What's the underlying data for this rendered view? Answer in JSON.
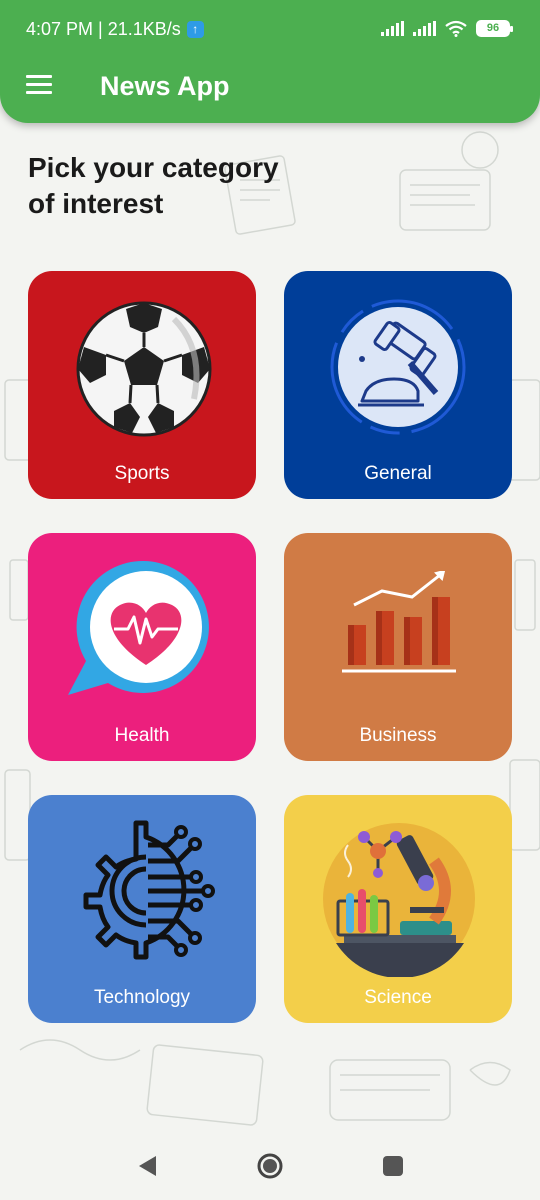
{
  "status_bar": {
    "time_speed": "4:07 PM | 21.1KB/s",
    "upload_icon": "arrow-up-icon",
    "battery": "96"
  },
  "app_bar": {
    "title": "News App",
    "menu_icon": "hamburger-menu-icon"
  },
  "page": {
    "title": "Pick your category\n of interest"
  },
  "categories": [
    {
      "label": "Sports",
      "color": "#c8161d",
      "icon": "soccer-ball-icon"
    },
    {
      "label": "General",
      "color": "#003e99",
      "icon": "gavel-icon"
    },
    {
      "label": "Health",
      "color": "#ec1f7d",
      "icon": "heartbeat-icon"
    },
    {
      "label": "Business",
      "color": "#d07b45",
      "icon": "bar-chart-growth-icon"
    },
    {
      "label": "Technology",
      "color": "#4b80cf",
      "icon": "circuit-gear-icon"
    },
    {
      "label": "Science",
      "color": "#f3cf4a",
      "icon": "microscope-icon"
    }
  ],
  "nav": {
    "back": "back-icon",
    "home": "home-icon",
    "recents": "recents-icon"
  },
  "colors": {
    "app_bar": "#4caf50",
    "background": "#f3f4f1"
  }
}
